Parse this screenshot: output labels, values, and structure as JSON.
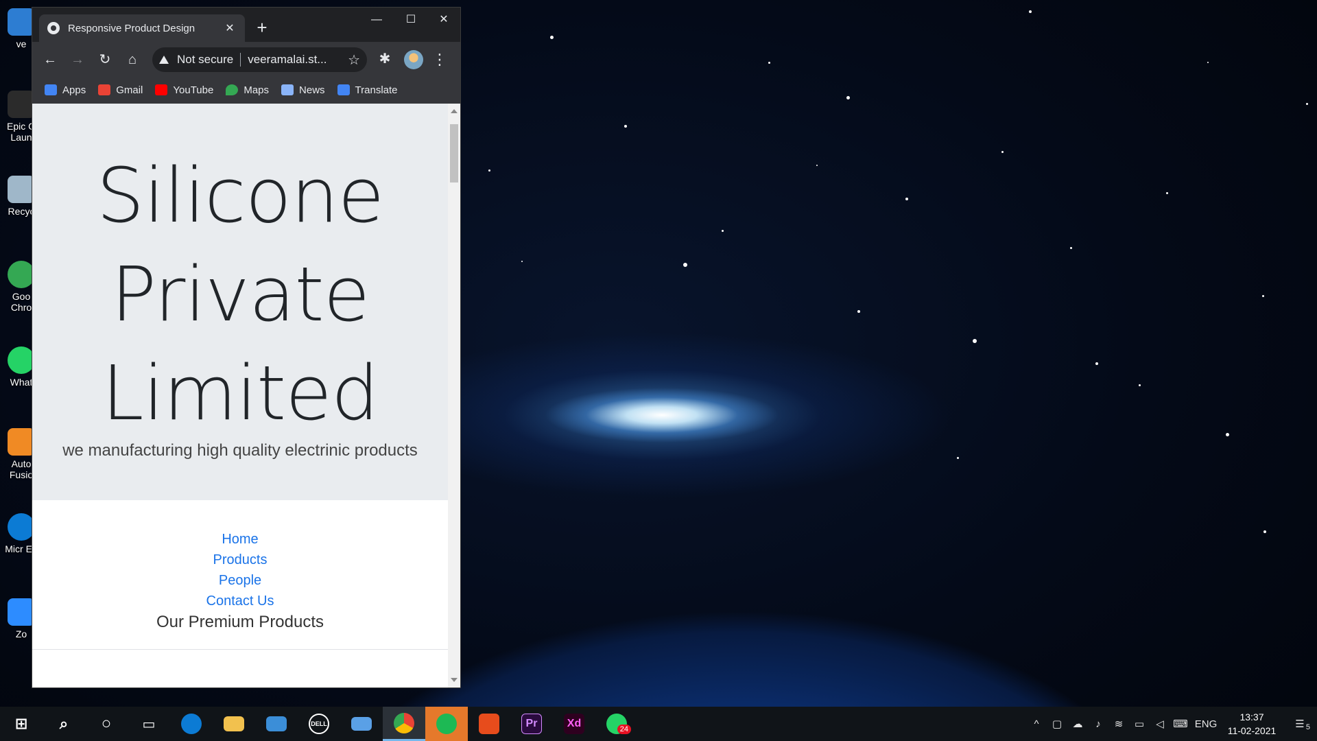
{
  "browser": {
    "tab_title": "Responsive Product Design",
    "tab_close": "✕",
    "new_tab": "+",
    "window_controls": {
      "minimize": "—",
      "maximize": "☐",
      "close": "✕"
    },
    "security_label": "Not secure",
    "url": "veeramalai.st...",
    "bookmarks": [
      {
        "label": "Apps",
        "color": "#4285f4"
      },
      {
        "label": "Gmail",
        "color": "#ea4335"
      },
      {
        "label": "YouTube",
        "color": "#ff0000"
      },
      {
        "label": "Maps",
        "color": "#34a853"
      },
      {
        "label": "News",
        "color": "#8ab4f8"
      },
      {
        "label": "Translate",
        "color": "#4285f4"
      }
    ]
  },
  "page": {
    "hero_title_lines": [
      "Silicone",
      "Private",
      "Limited"
    ],
    "hero_subtitle": "we manufacturing high quality electrinic products",
    "nav": [
      "Home",
      "Products",
      "People",
      "Contact Us"
    ],
    "section_title": "Our Premium Products",
    "link_color": "#1a73e8"
  },
  "desktop": {
    "icons": [
      "ve",
      "Epic G Laun",
      "Recyc",
      "Goo Chro",
      "What",
      "Auto Fusio",
      "Micr Ed",
      "Zo"
    ]
  },
  "taskbar": {
    "apps": [
      "start",
      "search",
      "cortana",
      "task-view",
      "edge",
      "file-explorer",
      "mail",
      "dell",
      "app",
      "chrome",
      "spotify",
      "office",
      "premiere",
      "xd",
      "whatsapp"
    ],
    "whatsapp_badge": "24",
    "language": "ENG",
    "time": "13:37",
    "date": "11-02-2021",
    "notification_count": "5"
  }
}
